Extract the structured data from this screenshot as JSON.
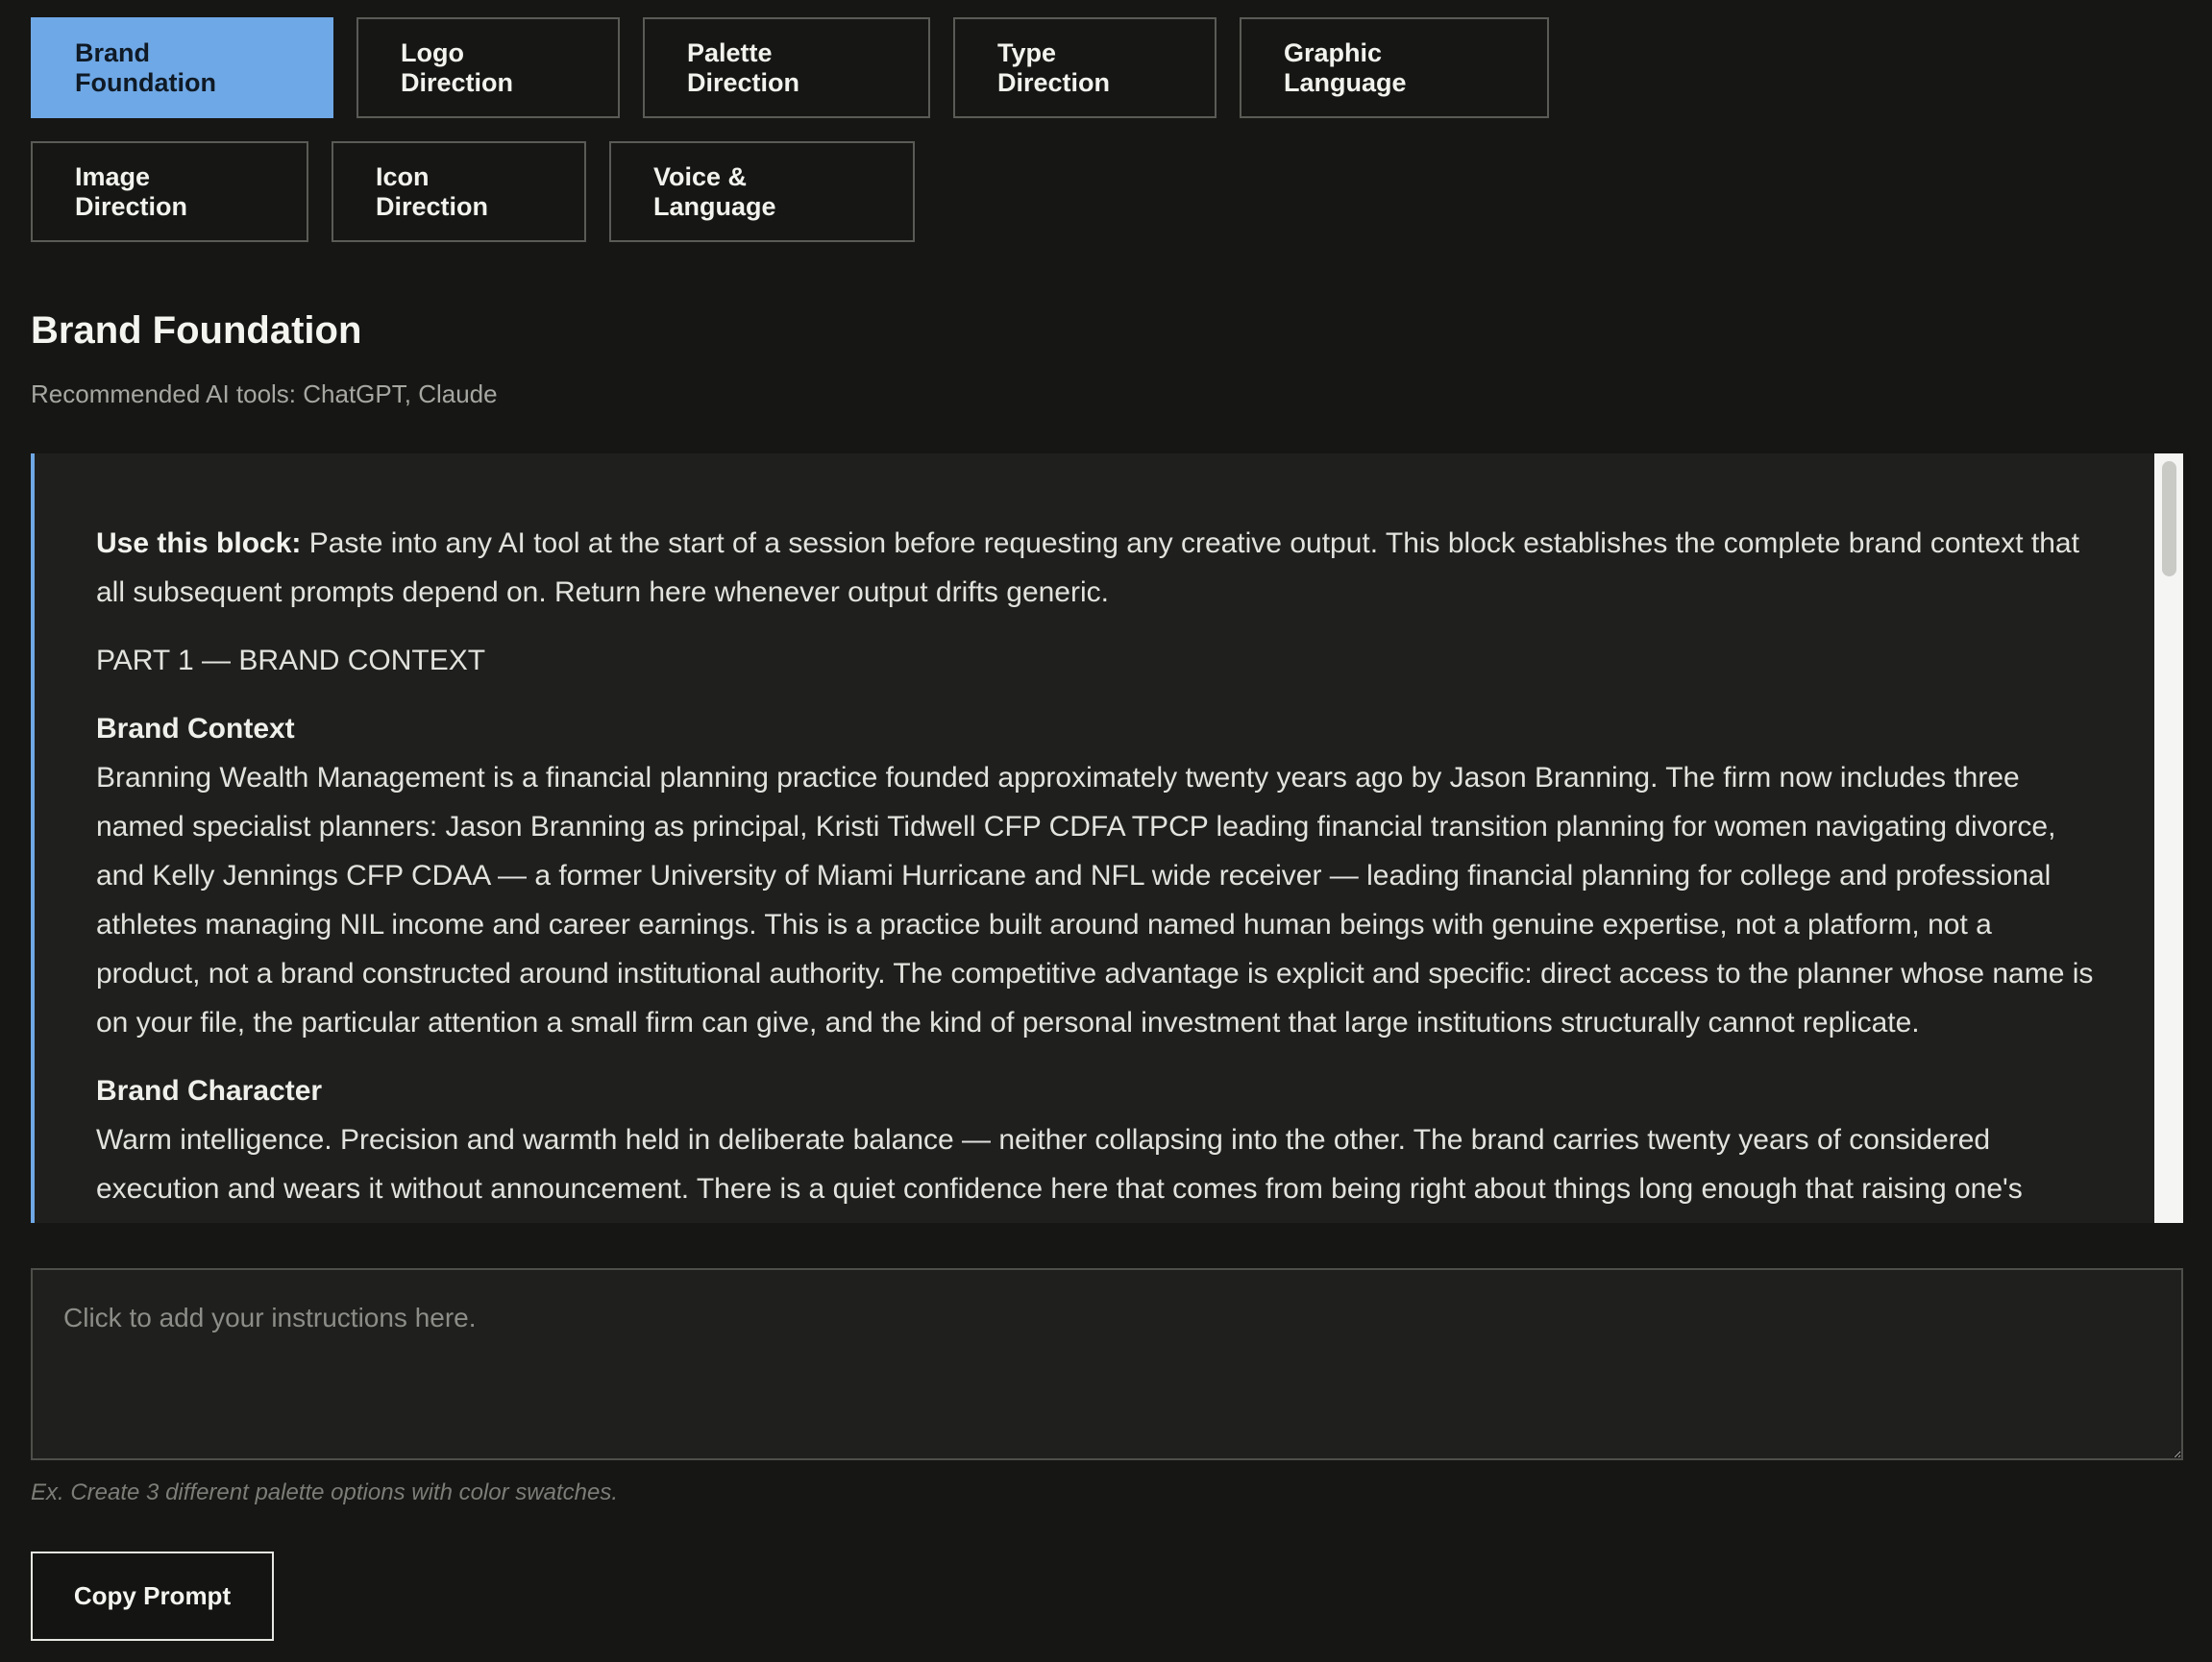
{
  "tabs": [
    {
      "label": "Brand Foundation",
      "active": true
    },
    {
      "label": "Logo Direction"
    },
    {
      "label": "Palette Direction"
    },
    {
      "label": "Type Direction"
    },
    {
      "label": "Graphic Language"
    },
    {
      "label": "Image Direction"
    },
    {
      "label": "Icon Direction"
    },
    {
      "label": "Voice & Language"
    }
  ],
  "section": {
    "title": "Brand Foundation",
    "subtitle": "Recommended AI tools: ChatGPT, Claude"
  },
  "prompt": {
    "use_label": "Use this block:",
    "use_text": " Paste into any AI tool at the start of a session before requesting any creative output. This block establishes the complete brand context that all subsequent prompts depend on. Return here whenever output drifts generic.",
    "part_heading": "PART 1 — BRAND CONTEXT",
    "brand_context_heading": "Brand Context",
    "brand_context_text": "Branning Wealth Management is a financial planning practice founded approximately twenty years ago by Jason Branning. The firm now includes three named specialist planners: Jason Branning as principal, Kristi Tidwell CFP CDFA TPCP leading financial transition planning for women navigating divorce, and Kelly Jennings CFP CDAA — a former University of Miami Hurricane and NFL wide receiver — leading financial planning for college and professional athletes managing NIL income and career earnings. This is a practice built around named human beings with genuine expertise, not a platform, not a product, not a brand constructed around institutional authority. The competitive advantage is explicit and specific: direct access to the planner whose name is on your file, the particular attention a small firm can give, and the kind of personal investment that large institutions structurally cannot replicate.",
    "brand_character_heading": "Brand Character",
    "brand_character_text": "Warm intelligence. Precision and warmth held in deliberate balance — neither collapsing into the other. The brand carries twenty years of considered execution and wears it without announcement. There is a quiet confidence here that comes from being right about things long enough that raising one's"
  },
  "instructions": {
    "placeholder": "Click to add your instructions here.",
    "hint": "Ex. Create 3 different palette options with color swatches."
  },
  "copy_button": {
    "label": "Copy Prompt"
  }
}
